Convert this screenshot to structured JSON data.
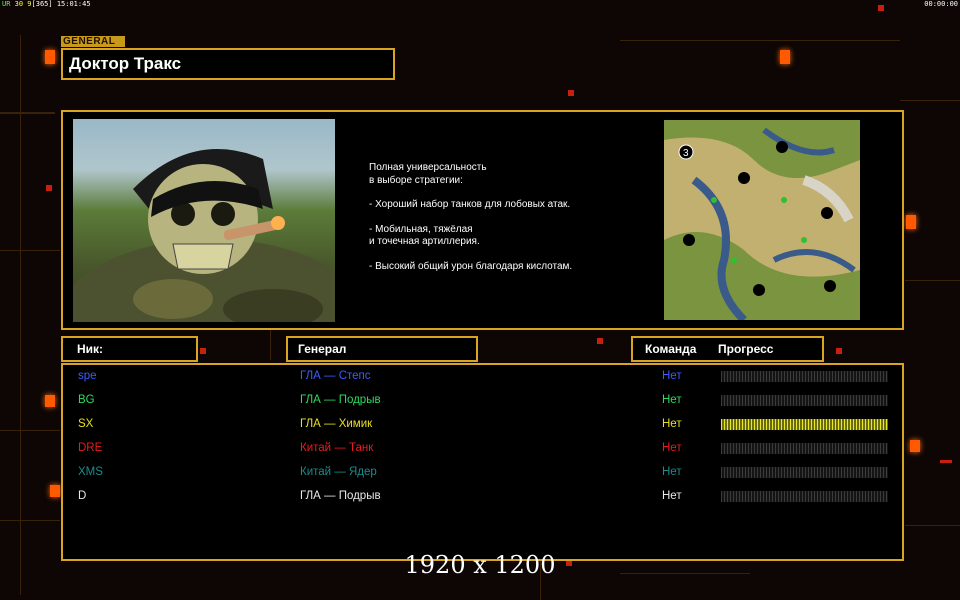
{
  "hud": {
    "left_prefix": "UR",
    "left_version": "30 9",
    "left_fps": "[365]",
    "left_time": "15:01:45",
    "right_time": "00:00:00"
  },
  "general_tag": "GENERAL",
  "title": "Доктор Тракс",
  "description": {
    "line1": "Полная универсальность",
    "line2": "в выборе стратегии:",
    "bullet1": "- Хороший набор танков для лобовых атак.",
    "bullet2a": "- Мобильная, тяжёлая",
    "bullet2b": "и точечная артиллерия.",
    "bullet3": "- Высокий общий урон благодаря кислотам."
  },
  "minimap": {
    "player_number": "3"
  },
  "headers": {
    "nick": "Ник:",
    "general": "Генерал",
    "team": "Команда",
    "progress": "Прогресс"
  },
  "players": [
    {
      "nick": "spe",
      "general": "ГЛА — Степс",
      "team": "Нет",
      "color": "#3b5cff",
      "team_color": "#3b5cff",
      "progress": 0
    },
    {
      "nick": "BG",
      "general": "ГЛА — Подрыв",
      "team": "Нет",
      "color": "#2cdc5c",
      "team_color": "#2cdc5c",
      "progress": 0
    },
    {
      "nick": "SX",
      "general": "ГЛА — Химик",
      "team": "Нет",
      "color": "#e8e01c",
      "team_color": "#e8e01c",
      "progress": 1
    },
    {
      "nick": "DRE",
      "general": "Китай — Танк",
      "team": "Нет",
      "color": "#e81c1c",
      "team_color": "#e81c1c",
      "progress": 0
    },
    {
      "nick": "XMS",
      "general": "Китай — Ядер",
      "team": "Нет",
      "color": "#1c8c8c",
      "team_color": "#1c8c8c",
      "progress": 0
    },
    {
      "nick": "D",
      "general": "ГЛА — Подрыв",
      "team": "Нет",
      "color": "#e8e8e8",
      "team_color": "#e8e8e8",
      "progress": 0
    }
  ],
  "footer_text": "1920 x 1200"
}
